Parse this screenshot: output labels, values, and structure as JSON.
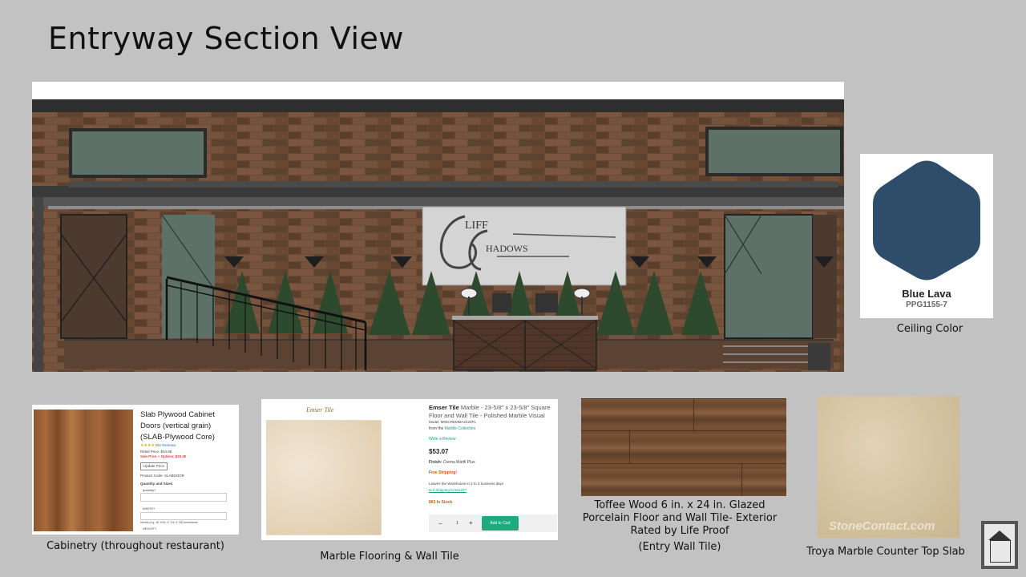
{
  "slide": {
    "title": "Entryway Section View"
  },
  "drawing": {
    "sign_line1": "LIFF",
    "sign_line2": "HADOWS"
  },
  "paint": {
    "name": "Blue Lava",
    "code": "PPG1155-7",
    "color": "#2e4d6b",
    "caption": "Ceiling Color"
  },
  "cabinet": {
    "product_title": "Slab Plywood Cabinet Doors (vertical grain) (SLAB-Plywood Core)",
    "reviews": "22 Reviews",
    "retail_price": "Retail Price: $34.95",
    "sale_price": "Sale Price + Options: $29.95",
    "update_button": "Update Price",
    "product_code": "Product Code: SLABDOOR",
    "qty_header": "Quantity and Sizes",
    "field1": "quantity?",
    "field2": "WIDTH?",
    "note": "Inches (e.g. 16 1/16, 17 1/4, 5 7/8) increments",
    "field3": "HEIGHT?",
    "caption": "Cabinetry (throughout restaurant)"
  },
  "marble": {
    "logo": "Emser Tile",
    "brand": "Emser Tile",
    "desc": "Marble - 23-5/8\" x 23-5/8\" Square Floor and Wall Tile - Polished Marble Visual",
    "model": "Model: M05CREMMA2424PL",
    "from_prefix": "from the",
    "collection": "Marble Collection",
    "review_link": "Write a Review",
    "price": "$53.07",
    "finish_label": "Finish:",
    "finish_value": "Crema Marfil Plus",
    "shipping": "Free Shipping!",
    "leaves": "Leaves the Warehouse in 2 to 3 business days",
    "ship_link": "Not Shipping to 94122?",
    "stock": "863 In Stock",
    "qty_minus": "−",
    "qty_value": "1",
    "qty_plus": "+",
    "cart_button": "Add to Cart",
    "caption": "Marble  Flooring & Wall Tile"
  },
  "toffee": {
    "caption_line1": "Toffee Wood 6 in. x 24 in. Glazed",
    "caption_line2": "Porcelain Floor and Wall Tile- Exterior",
    "caption_line3": "Rated by Life Proof",
    "caption_line4": "(Entry Wall Tile)"
  },
  "troya": {
    "watermark": "StoneContact.com",
    "caption": "Troya Marble  Counter Top Slab"
  },
  "colors": {
    "background": "#c2c2c2",
    "brick": "#6b4a36",
    "window": "#5e7168",
    "add_to_cart": "#1fa97f"
  }
}
